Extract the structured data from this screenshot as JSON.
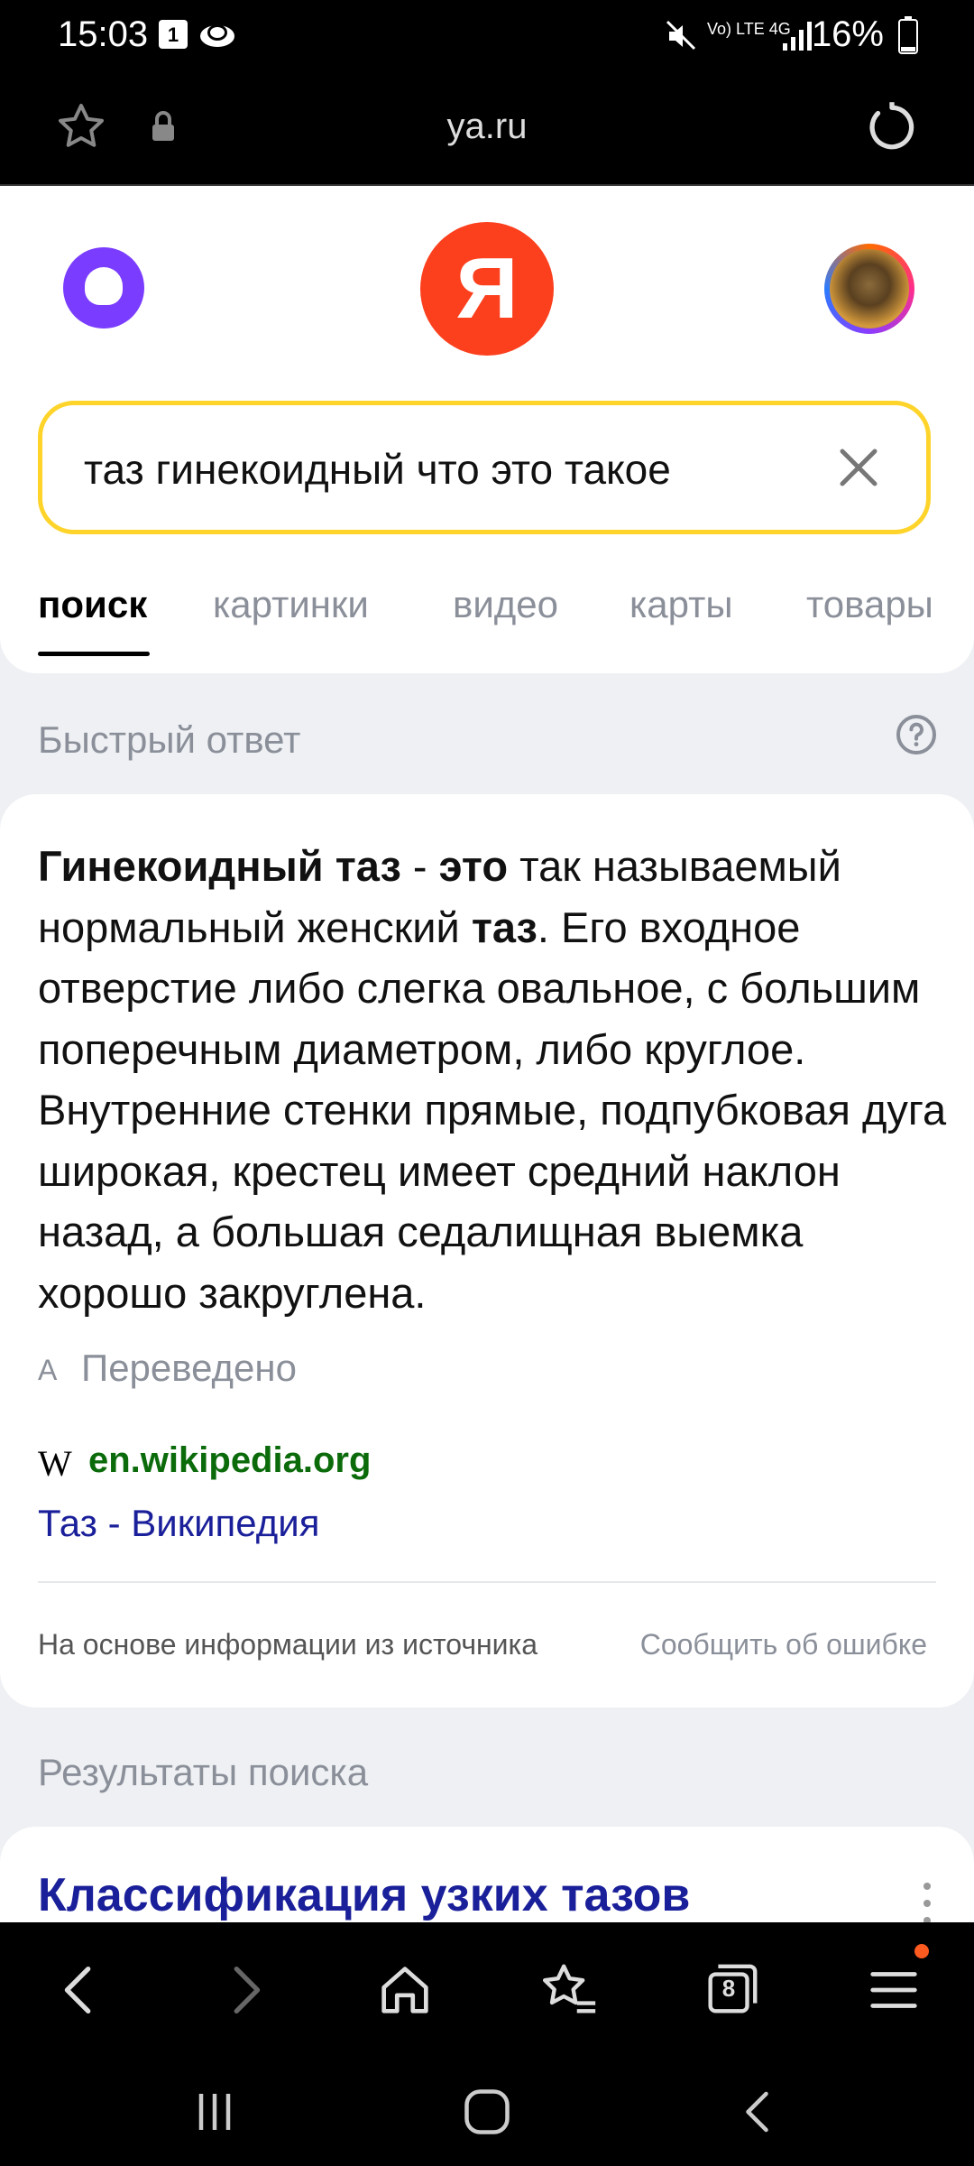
{
  "status_bar": {
    "time": "15:03",
    "notification_badge": "1",
    "network": "Vo) LTE 4G",
    "battery": "16%"
  },
  "browser": {
    "url": "ya.ru",
    "tab_count": "8"
  },
  "header": {
    "logo_letter": "Я"
  },
  "search": {
    "query": "таз гинекоидный что это такое"
  },
  "tabs": [
    {
      "label": "поиск"
    },
    {
      "label": "картинки"
    },
    {
      "label": "видео"
    },
    {
      "label": "карты"
    },
    {
      "label": "товары"
    }
  ],
  "quick_answer": {
    "section_title": "Быстрый ответ",
    "term": "Гинекоидный таз",
    "dash": " - ",
    "is": "это",
    "text_1": " так называемый нормальный женский ",
    "bold_2": "таз",
    "text_2": ". Его входное отверстие либо слегка овальное, с большим поперечным диаметром, либо круглое. Внутренние стенки прямые, подпубковая дуга широкая, крестец имеет средний наклон назад, а большая седалищная выемка хорошо закруглена.",
    "translated_label": "Переведено",
    "source_icon": "W",
    "source_domain": "en.wikipedia.org",
    "source_title": "Таз - Википедия",
    "based_on": "На основе информации из источника",
    "report_error": "Сообщить об ошибке"
  },
  "results": {
    "section_title": "Результаты поиска",
    "first_title": "Классификация узких тазов"
  },
  "colors": {
    "yandex_red": "#fc3f1d",
    "search_border": "#fed42b",
    "link": "#1a1f9a",
    "domain_green": "#0b6b0b",
    "alice": "#7a3cff"
  }
}
